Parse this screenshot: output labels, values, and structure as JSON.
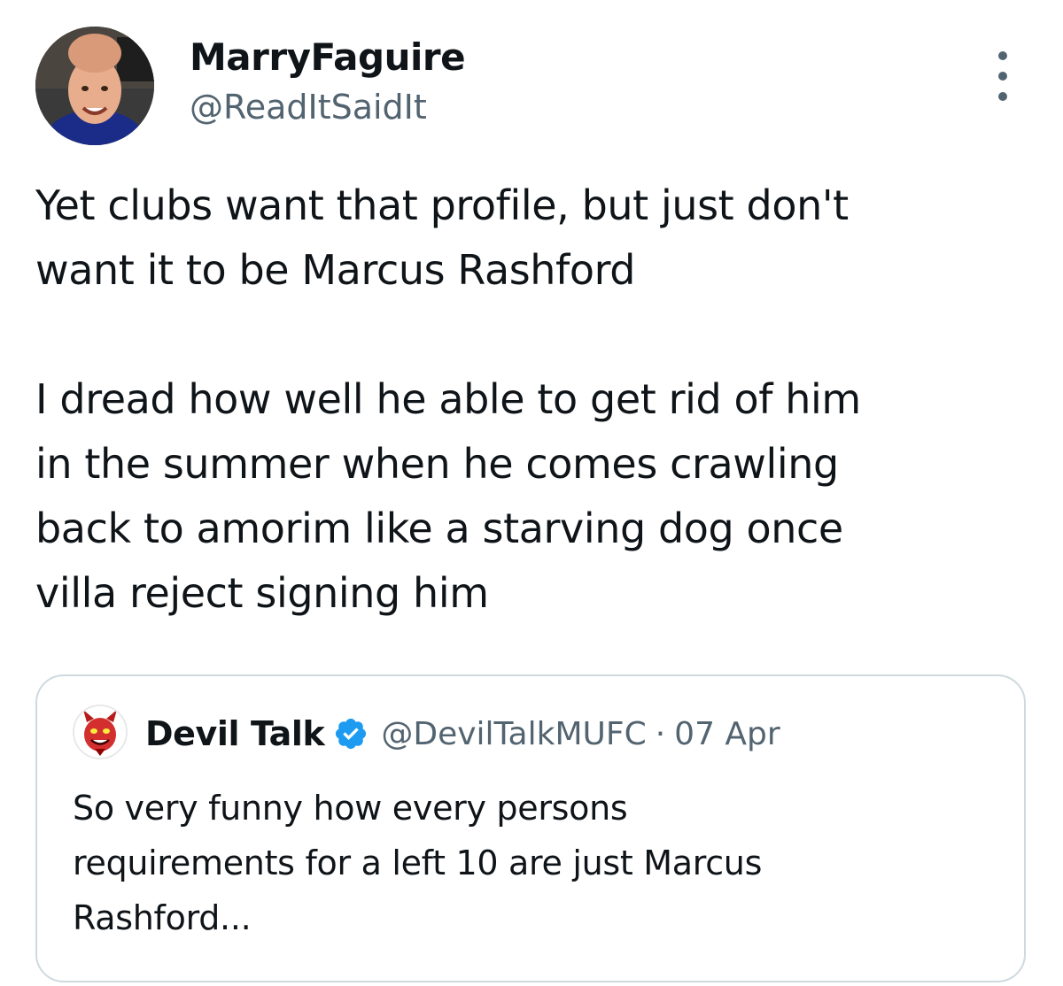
{
  "author": {
    "display_name": "MarryFaguire",
    "handle": "@ReadItSaidIt",
    "avatar_icon": "profile-photo"
  },
  "more_icon": "more-options-icon",
  "tweet": {
    "paragraphs": [
      [
        "Yet clubs want that profile, but just don't",
        "want it to be Marcus Rashford"
      ],
      [
        "I dread how well he able to get rid of him",
        "in the summer when he comes crawling",
        "back to amorim like a starving dog once",
        "villa reject signing him"
      ]
    ]
  },
  "quote": {
    "display_name": "Devil Talk",
    "verified_icon": "verified-badge-icon",
    "handle": "@DevilTalkMUFC",
    "separator": "·",
    "date": "07 Apr",
    "lines": [
      "So very funny how every persons",
      "requirements for a left 10 are just Marcus",
      "Rashford..."
    ]
  },
  "colors": {
    "text": "#0f1419",
    "secondary": "#536471",
    "border": "#cfd9de",
    "verified": "#1d9bf0"
  }
}
